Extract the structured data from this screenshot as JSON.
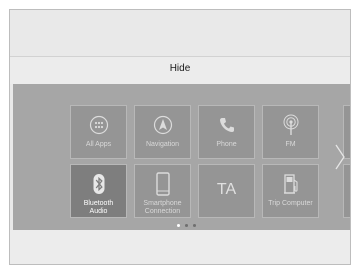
{
  "header": {
    "hide_label": "Hide"
  },
  "apps": [
    {
      "label": "All Apps",
      "icon": "all-apps-icon"
    },
    {
      "label": "Navigation",
      "icon": "navigation-icon"
    },
    {
      "label": "Phone",
      "icon": "phone-icon"
    },
    {
      "label": "FM",
      "icon": "fm-radio-icon"
    },
    {
      "label": "Bluetooth\nAudio",
      "icon": "bluetooth-icon"
    },
    {
      "label": "Smartphone\nConnection",
      "icon": "smartphone-icon"
    },
    {
      "label": "TA",
      "icon": ""
    },
    {
      "label": "Trip Computer",
      "icon": "fuel-pump-icon"
    }
  ],
  "pagination": {
    "current_page": 1,
    "total_pages": 3
  },
  "colors": {
    "panel": "#a6a6a6",
    "tile": "#959595",
    "selected_tile": "#7e7e7e",
    "active_dot": "#ffffff"
  }
}
